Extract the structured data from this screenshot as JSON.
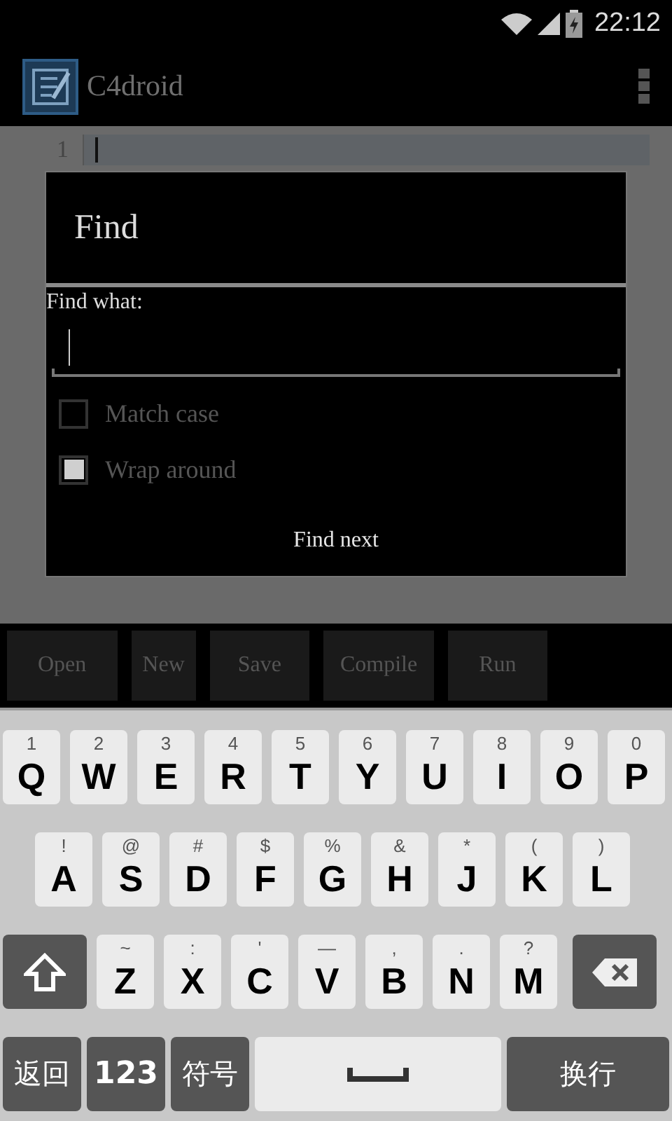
{
  "status_bar": {
    "time": "22:12"
  },
  "app_bar": {
    "title": "C4droid"
  },
  "editor": {
    "line_numbers": [
      "1"
    ]
  },
  "find_dialog": {
    "title": "Find",
    "field_label": "Find what:",
    "options": [
      {
        "label": "Match case",
        "checked": false
      },
      {
        "label": "Wrap around",
        "checked": true
      }
    ],
    "button": "Find next"
  },
  "toolbar": [
    "Open",
    "New",
    "Save",
    "Compile",
    "Run"
  ],
  "keyboard": {
    "rows": [
      [
        {
          "kind": "letter",
          "main": "Q",
          "hint": "1"
        },
        {
          "kind": "letter",
          "main": "W",
          "hint": "2"
        },
        {
          "kind": "letter",
          "main": "E",
          "hint": "3"
        },
        {
          "kind": "letter",
          "main": "R",
          "hint": "4"
        },
        {
          "kind": "letter",
          "main": "T",
          "hint": "5"
        },
        {
          "kind": "letter",
          "main": "Y",
          "hint": "6"
        },
        {
          "kind": "letter",
          "main": "U",
          "hint": "7"
        },
        {
          "kind": "letter",
          "main": "I",
          "hint": "8"
        },
        {
          "kind": "letter",
          "main": "O",
          "hint": "9"
        },
        {
          "kind": "letter",
          "main": "P",
          "hint": "0"
        }
      ],
      [
        {
          "kind": "letter",
          "main": "A",
          "hint": "!"
        },
        {
          "kind": "letter",
          "main": "S",
          "hint": "@"
        },
        {
          "kind": "letter",
          "main": "D",
          "hint": "#"
        },
        {
          "kind": "letter",
          "main": "F",
          "hint": "$"
        },
        {
          "kind": "letter",
          "main": "G",
          "hint": "%"
        },
        {
          "kind": "letter",
          "main": "H",
          "hint": "&"
        },
        {
          "kind": "letter",
          "main": "J",
          "hint": "*"
        },
        {
          "kind": "letter",
          "main": "K",
          "hint": "("
        },
        {
          "kind": "letter",
          "main": "L",
          "hint": ")"
        }
      ],
      [
        {
          "kind": "shift"
        },
        {
          "kind": "letter",
          "main": "Z",
          "hint": "~"
        },
        {
          "kind": "letter",
          "main": "X",
          "hint": ":"
        },
        {
          "kind": "letter",
          "main": "C",
          "hint": "'"
        },
        {
          "kind": "letter",
          "main": "V",
          "hint": "—"
        },
        {
          "kind": "letter",
          "main": "B",
          "hint": ","
        },
        {
          "kind": "letter",
          "main": "N",
          "hint": "."
        },
        {
          "kind": "letter",
          "main": "M",
          "hint": "?"
        },
        {
          "kind": "backspace"
        }
      ]
    ],
    "bottom_bar": [
      {
        "kind": "function",
        "main": "返回"
      },
      {
        "kind": "mode",
        "main": "123"
      },
      {
        "kind": "function",
        "main": "符号"
      },
      {
        "kind": "space"
      },
      {
        "kind": "enter",
        "main": "换行"
      }
    ]
  }
}
